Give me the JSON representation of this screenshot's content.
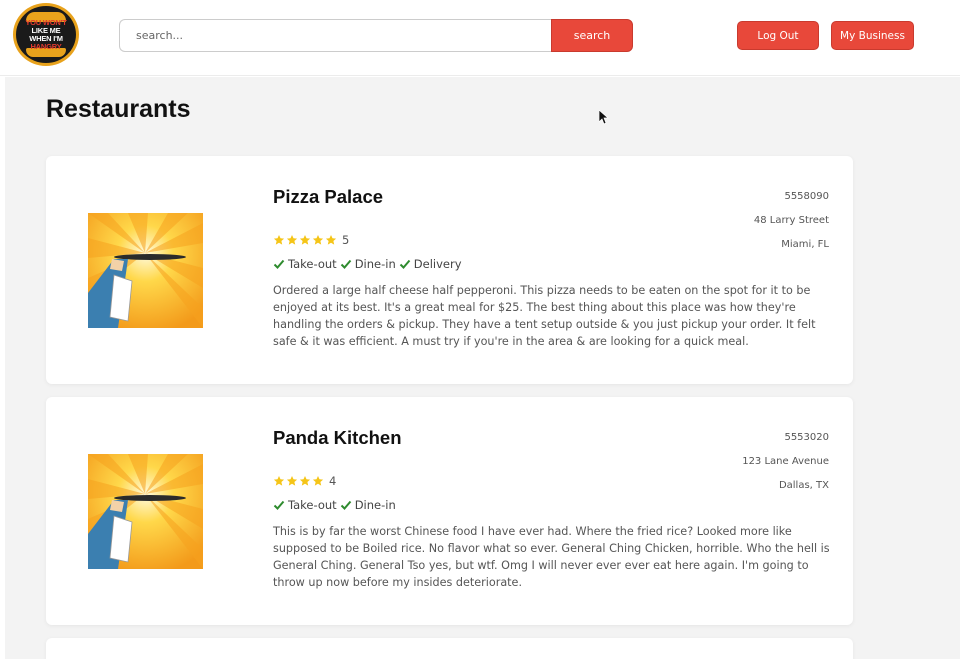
{
  "header": {
    "logo_lines": [
      "YOU WON'T",
      "LIKE ME",
      "WHEN I'M",
      "HANGRY"
    ],
    "search_placeholder": "search...",
    "search_button": "search",
    "logout_button": "Log Out",
    "business_button": "My Business"
  },
  "main": {
    "title": "Restaurants",
    "restaurants": [
      {
        "name": "Pizza Palace",
        "phone": "5558090",
        "street": "48 Larry Street",
        "city": "Miami, FL",
        "stars": 5,
        "rating": "5",
        "services": [
          "Take-out",
          "Dine-in",
          "Delivery"
        ],
        "review": "Ordered a large half cheese half pepperoni. This pizza needs to be eaten on the spot for it to be enjoyed at its best. It's a great meal for $25. The best thing about this place was how they're handling the orders & pickup. They have a tent setup outside & you just pickup your order. It felt safe & it was efficient. A must try if you're in the area & are looking for a quick meal."
      },
      {
        "name": "Panda Kitchen",
        "phone": "5553020",
        "street": "123 Lane Avenue",
        "city": "Dallas, TX",
        "stars": 4,
        "rating": "4",
        "services": [
          "Take-out",
          "Dine-in"
        ],
        "review": "This is by far the worst Chinese food I have ever had. Where the fried rice? Looked more like supposed to be Boiled rice. No flavor what so ever. General Ching Chicken, horrible. Who the hell is General Ching. General Tso yes, but wtf. Omg I will never ever ever eat here again. I'm going to throw up now before my insides deteriorate."
      }
    ]
  },
  "colors": {
    "accent": "#e8483a",
    "star": "#f5c518",
    "check": "#2e8b2e",
    "background": "#f3f3f3"
  },
  "icons": {
    "star": "star-icon",
    "check": "check-icon",
    "cursor": "mouse-cursor-icon"
  }
}
